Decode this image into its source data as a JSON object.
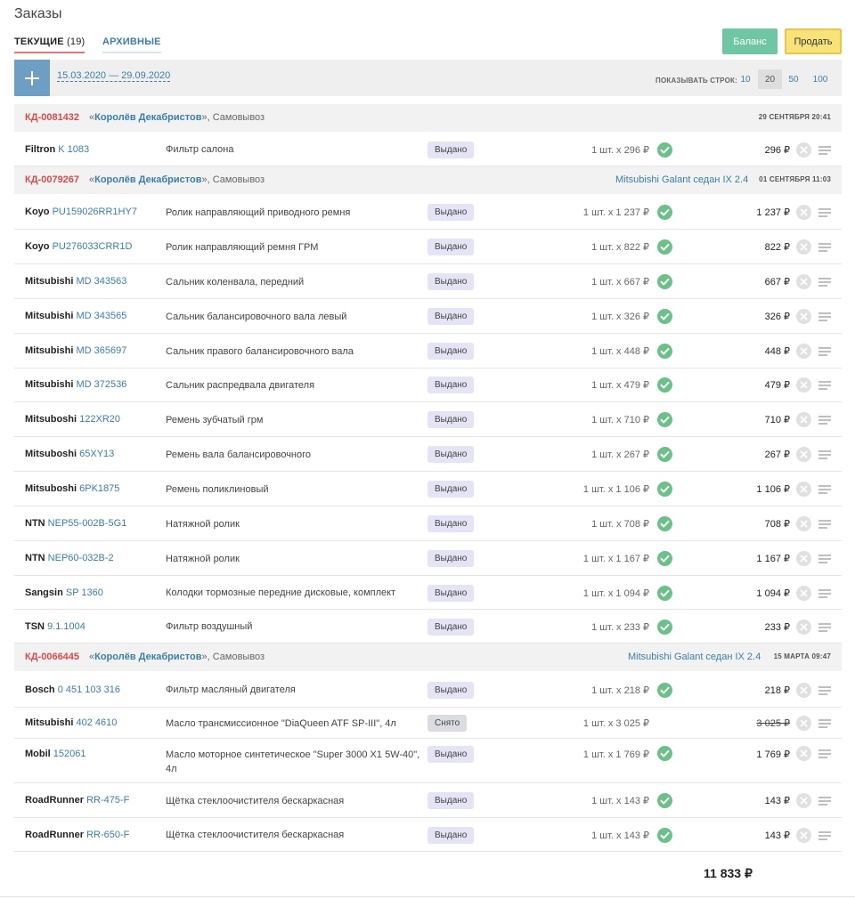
{
  "page": {
    "title": "Заказы"
  },
  "tabs": {
    "current_label": "ТЕКУЩИЕ",
    "current_count": "(19)",
    "archive_label": "АРХИВНЫЕ"
  },
  "buttons": {
    "balance": "Баланс",
    "sell": "Продать"
  },
  "toolbar": {
    "date_range": "15.03.2020 — 29.09.2020",
    "rows_label": "ПОКАЗЫВАТЬ СТРОК:",
    "rows_options": [
      "10",
      "20",
      "50",
      "100"
    ],
    "rows_selected": "20"
  },
  "currency": "₽",
  "orders": [
    {
      "id": "КД-0081432",
      "shop": "Королёв Декабристов",
      "delivery": ", Самовывоз",
      "car": "",
      "date": "29 СЕНТЯБРЯ 20:41",
      "items": [
        {
          "brand": "Filtron",
          "article": "K 1083",
          "description": "Фильтр салона",
          "status": "Выдано",
          "qty": "1 шт. x 296 ₽",
          "price": "296 ₽"
        }
      ]
    },
    {
      "id": "КД-0079267",
      "shop": "Королёв Декабристов",
      "delivery": ", Самовывоз",
      "car": "Mitsubishi Galant седан IX 2.4",
      "date": "01 СЕНТЯБРЯ 11:03",
      "items": [
        {
          "brand": "Koyo",
          "article": "PU159026RR1HY7",
          "description": "Ролик направляющий приводного ремня",
          "status": "Выдано",
          "qty": "1 шт. x 1 237 ₽",
          "price": "1 237 ₽"
        },
        {
          "brand": "Koyo",
          "article": "PU276033CRR1D",
          "description": "Ролик направляющий ремня ГРМ",
          "status": "Выдано",
          "qty": "1 шт. x 822 ₽",
          "price": "822 ₽"
        },
        {
          "brand": "Mitsubishi",
          "article": "MD 343563",
          "description": "Сальник коленвала, передний",
          "status": "Выдано",
          "qty": "1 шт. x 667 ₽",
          "price": "667 ₽"
        },
        {
          "brand": "Mitsubishi",
          "article": "MD 343565",
          "description": "Сальник балансировочного вала левый",
          "status": "Выдано",
          "qty": "1 шт. x 326 ₽",
          "price": "326 ₽"
        },
        {
          "brand": "Mitsubishi",
          "article": "MD 365697",
          "description": "Сальник правого балансировочного вала",
          "status": "Выдано",
          "qty": "1 шт. x 448 ₽",
          "price": "448 ₽"
        },
        {
          "brand": "Mitsubishi",
          "article": "MD 372536",
          "description": "Сальник распредвала двигателя",
          "status": "Выдано",
          "qty": "1 шт. x 479 ₽",
          "price": "479 ₽"
        },
        {
          "brand": "Mitsuboshi",
          "article": "122XR20",
          "description": "Ремень зубчатый грм",
          "status": "Выдано",
          "qty": "1 шт. x 710 ₽",
          "price": "710 ₽"
        },
        {
          "brand": "Mitsuboshi",
          "article": "65XY13",
          "description": "Ремень вала балансировочного",
          "status": "Выдано",
          "qty": "1 шт. x 267 ₽",
          "price": "267 ₽"
        },
        {
          "brand": "Mitsuboshi",
          "article": "6PK1875",
          "description": "Ремень поликлиновый",
          "status": "Выдано",
          "qty": "1 шт. x 1 106 ₽",
          "price": "1 106 ₽"
        },
        {
          "brand": "NTN",
          "article": "NEP55-002B-5G1",
          "description": "Натяжной ролик",
          "status": "Выдано",
          "qty": "1 шт. x 708 ₽",
          "price": "708 ₽"
        },
        {
          "brand": "NTN",
          "article": "NEP60-032B-2",
          "description": "Натяжной ролик",
          "status": "Выдано",
          "qty": "1 шт. x 1 167 ₽",
          "price": "1 167 ₽"
        },
        {
          "brand": "Sangsin",
          "article": "SP 1360",
          "description": "Колодки тормозные передние дисковые, комплект",
          "status": "Выдано",
          "qty": "1 шт. x 1 094 ₽",
          "price": "1 094 ₽"
        },
        {
          "brand": "TSN",
          "article": "9.1.1004",
          "description": "Фильтр воздушный",
          "status": "Выдано",
          "qty": "1 шт. x 233 ₽",
          "price": "233 ₽"
        }
      ]
    },
    {
      "id": "КД-0066445",
      "shop": "Королёв Декабристов",
      "delivery": ", Самовывоз",
      "car": "Mitsubishi Galant седан IX 2.4",
      "date": "15 МАРТА 09:47",
      "items": [
        {
          "brand": "Bosch",
          "article": "0 451 103 316",
          "description": "Фильтр масляный двигателя",
          "status": "Выдано",
          "qty": "1 шт. x 218 ₽",
          "price": "218 ₽"
        },
        {
          "brand": "Mitsubishi",
          "article": "402 4610",
          "description": "Масло трансмиссионное \"DiaQueen ATF SP-III\", 4л",
          "status": "Снято",
          "qty": "1 шт. x 3 025 ₽",
          "price": "3 025 ₽"
        },
        {
          "brand": "Mobil",
          "article": "152061",
          "description": "Масло моторное синтетическое \"Super 3000 X1 5W-40\", 4л",
          "status": "Выдано",
          "qty": "1 шт. x 1 769 ₽",
          "price": "1 769 ₽"
        },
        {
          "brand": "RoadRunner",
          "article": "RR-475-F",
          "description": "Щётка стеклоочистителя бескаркасная",
          "status": "Выдано",
          "qty": "1 шт. x 143 ₽",
          "price": "143 ₽"
        },
        {
          "brand": "RoadRunner",
          "article": "RR-650-F",
          "description": "Щётка стеклоочистителя бескаркасная",
          "status": "Выдано",
          "qty": "1 шт. x 143 ₽",
          "price": "143 ₽"
        }
      ]
    }
  ],
  "total": "11 833 ₽",
  "colors": {
    "order_id": "#d84b4b",
    "link": "#3a7fa8",
    "ok": "#6cc189",
    "balance_btn": "#6fc6a3",
    "sell_btn": "#f7e37a",
    "add_btn": "#6f9ec4"
  }
}
